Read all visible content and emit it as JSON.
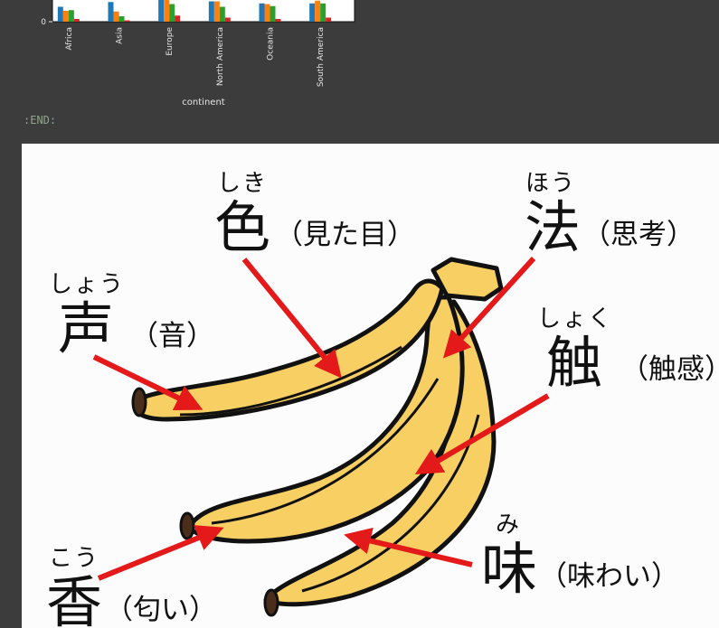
{
  "chart_data": {
    "type": "bar",
    "xlabel": "continent",
    "categories": [
      "Africa",
      "Asia",
      "Europe",
      "North America",
      "Oceania",
      "South America"
    ],
    "y_ticks": [
      "0"
    ],
    "series": [
      {
        "color": "#1f77b4",
        "values": [
          22,
          29,
          34,
          30,
          27,
          27
        ]
      },
      {
        "color": "#ff7f0e",
        "values": [
          16,
          15,
          34,
          30,
          26,
          31
        ]
      },
      {
        "color": "#2ca02c",
        "values": [
          17,
          8,
          26,
          22,
          23,
          27
        ]
      },
      {
        "color": "#d62728",
        "values": [
          4,
          2,
          9,
          6,
          4,
          6
        ]
      }
    ]
  },
  "end_marker": ":END:",
  "image": {
    "description_colors": {
      "banana": "#f7cf62",
      "outline": "#111111",
      "arrow": "#e3191a"
    },
    "labels": [
      {
        "id": "iro",
        "ruby": "しき",
        "kanji": "色",
        "meaning": "（見た目）"
      },
      {
        "id": "hou",
        "ruby": "ほう",
        "kanji": "法",
        "meaning": "（思考）"
      },
      {
        "id": "sei",
        "ruby": "しょう",
        "kanji": "声",
        "meaning": "（音）"
      },
      {
        "id": "shoku",
        "ruby": "しょく",
        "kanji": "触",
        "meaning": "（触感）"
      },
      {
        "id": "mi",
        "ruby": "み",
        "kanji": "味",
        "meaning": "（味わい）"
      },
      {
        "id": "kou",
        "ruby": "こう",
        "kanji": "香",
        "meaning": "（匂い）"
      }
    ]
  }
}
